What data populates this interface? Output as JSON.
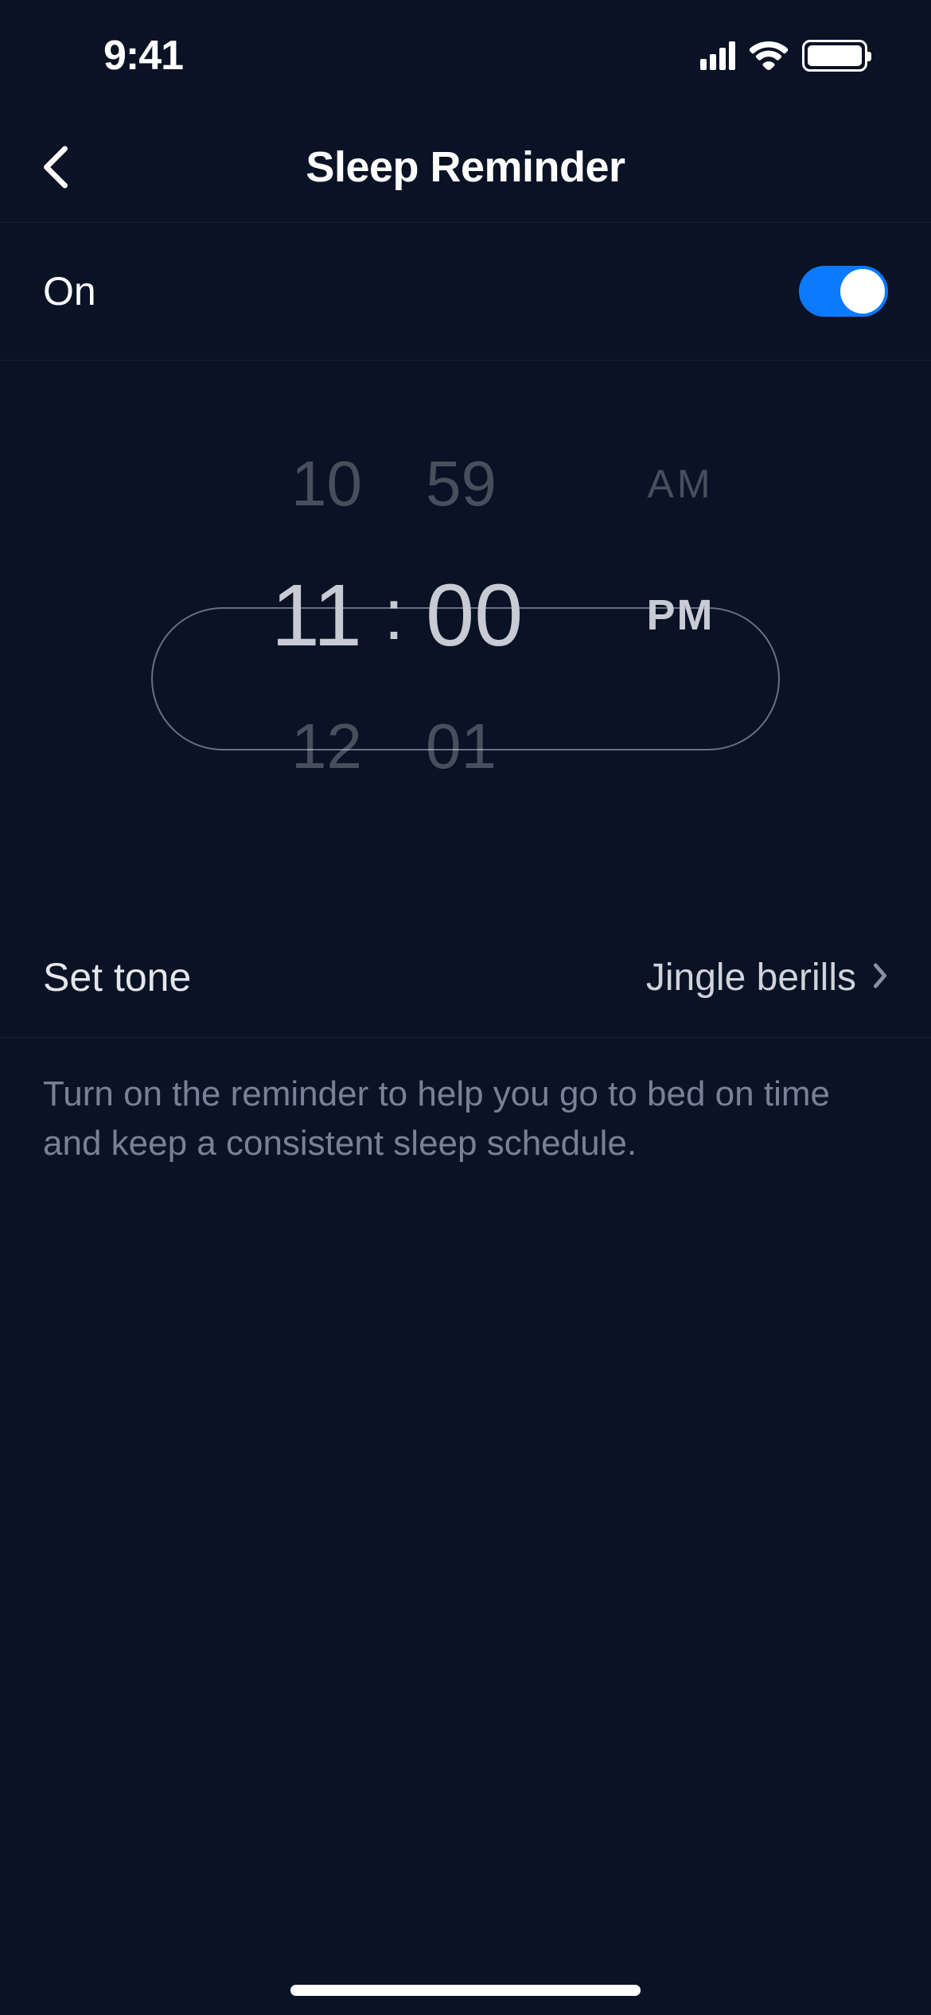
{
  "status_bar": {
    "time": "9:41"
  },
  "header": {
    "title": "Sleep Reminder"
  },
  "toggle": {
    "label": "On",
    "enabled": true
  },
  "time_picker": {
    "prev": {
      "hour": "10",
      "minute": "59",
      "period": "AM"
    },
    "selected": {
      "hour": "11",
      "separator": ":",
      "minute": "00",
      "period": "PM"
    },
    "next": {
      "hour": "12",
      "minute": "01",
      "period": ""
    }
  },
  "tone": {
    "label": "Set tone",
    "value": "Jingle berills"
  },
  "description": "Turn on the reminder to help you go to bed on time and keep a consistent sleep schedule."
}
